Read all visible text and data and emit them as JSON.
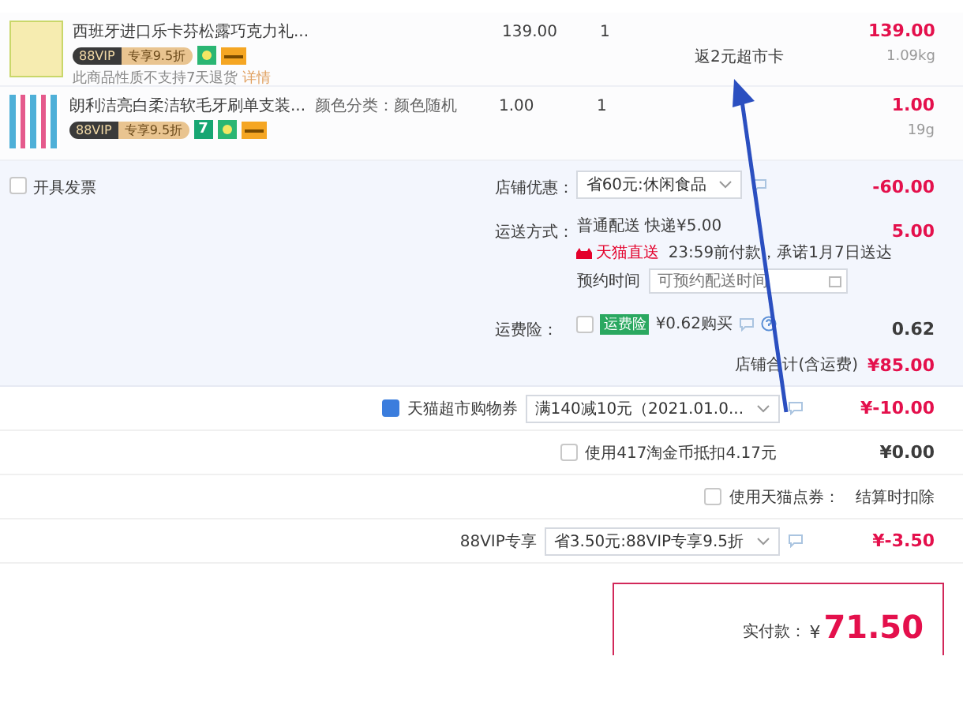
{
  "items": [
    {
      "title": "西班牙进口乐卡芬松露巧克力礼...",
      "price": "139.00",
      "quantity": "1",
      "promo": "返2元超市卡",
      "total": "139.00",
      "weight": "1.09kg",
      "vip": {
        "label": "88VIP",
        "text": "专享9.5折"
      },
      "tags": [
        {
          "kind": "icon"
        },
        {
          "kind": "card"
        }
      ],
      "note": {
        "text": "此商品性质不支持7天退货",
        "link": "详情"
      }
    },
    {
      "title": "朗利洁亮白柔洁软毛牙刷单支装...",
      "spec": "颜色分类：颜色随机",
      "price": "1.00",
      "quantity": "1",
      "total": "1.00",
      "weight": "19g",
      "vip": {
        "label": "88VIP",
        "text": "专享9.5折"
      },
      "tags": [
        {
          "kind": "text",
          "text": "7"
        },
        {
          "kind": "icon"
        },
        {
          "kind": "card"
        }
      ]
    }
  ],
  "shop": {
    "invoice": {
      "label": "开具发票",
      "checked": false
    },
    "discount": {
      "label": "店铺优惠：",
      "value": "省60元:休闲食品",
      "amount": "-60.00"
    },
    "shipping": {
      "label": "运送方式：",
      "method": "普通配送 快递¥5.00",
      "brand": "天猫直送",
      "promise": "23:59前付款，承诺1月7日送达",
      "schedule_label": "预约时间",
      "schedule_placeholder": "可预约配送时间",
      "amount": "5.00"
    },
    "insurance": {
      "label": "运费险：",
      "checked": false,
      "badge": "运费险",
      "price": "¥0.62购买",
      "amount": "0.62"
    },
    "total": {
      "label": "店铺合计(含运费)",
      "value": "¥85.00"
    }
  },
  "coupon": {
    "checked": true,
    "label": "天猫超市购物券",
    "value": "满140减10元（2021.01.0...",
    "amount": "¥-10.00"
  },
  "coins": {
    "checked": false,
    "label": "使用417淘金币抵扣4.17元",
    "amount": "¥0.00"
  },
  "points": {
    "checked": false,
    "label": "使用天猫点券：",
    "note": "结算时扣除"
  },
  "vip_discount": {
    "label": "88VIP专享",
    "value": "省3.50元:88VIP专享9.5折",
    "amount": "¥-3.50"
  },
  "payment": {
    "label": "实付款：",
    "currency": "¥",
    "amount": "71.50"
  }
}
